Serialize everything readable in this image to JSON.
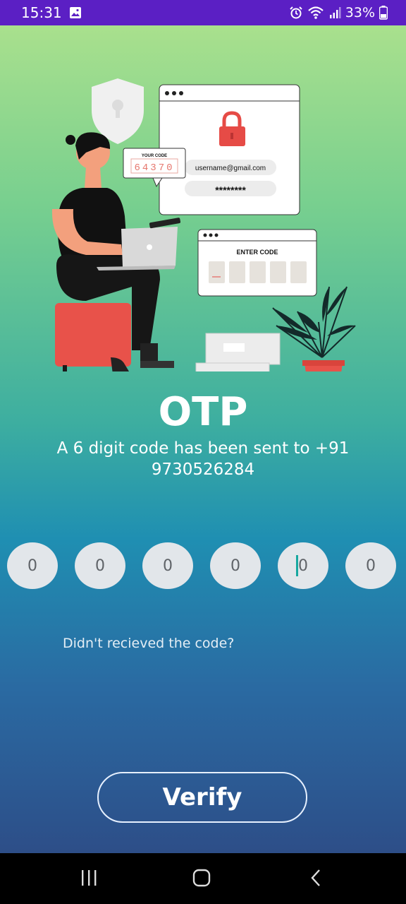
{
  "status_bar": {
    "time": "15:31",
    "battery": "33%",
    "icons": [
      "gallery-icon",
      "alarm-icon",
      "wifi-icon",
      "signal-icon",
      "battery-icon"
    ]
  },
  "illustration": {
    "your_code_label": "YOUR CODE",
    "your_code_value": "64370",
    "username": "username@gmail.com",
    "password": "********",
    "enter_code_label": "ENTER CODE"
  },
  "screen": {
    "title": "OTP",
    "subtitle": "A 6 digit code has been sent to +91 9730526284",
    "otp_digits": [
      "0",
      "0",
      "0",
      "0",
      "0",
      "0"
    ],
    "resend_text": "Didn't recieved the code?",
    "verify_label": "Verify"
  },
  "colors": {
    "status_bar": "#5b1fc4",
    "gradient_top": "#a9e08d",
    "gradient_bottom": "#2d4e88",
    "otp_box": "#e2e6ea",
    "cursor": "#17a8a0"
  },
  "nav_bar": {
    "icons": [
      "recent-apps-icon",
      "home-icon",
      "back-icon"
    ]
  }
}
